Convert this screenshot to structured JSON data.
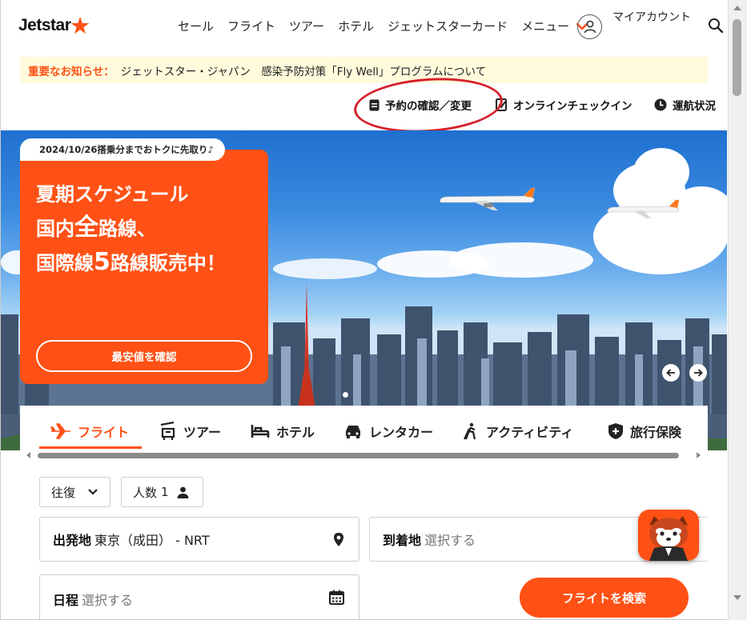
{
  "header": {
    "logo_text": "Jetstar",
    "nav": [
      "セール",
      "フライト",
      "ツアー",
      "ホテル",
      "ジェットスターカード",
      "メニュー"
    ],
    "account_label": "マイアカウント"
  },
  "notice": {
    "label": "重要なお知らせ：",
    "text": "ジェットスター・ジャパン　感染予防対策「Fly Well」プログラムについて"
  },
  "quick_links": {
    "booking": "予約の確認／変更",
    "checkin": "オンラインチェックイン",
    "status": "運航状況"
  },
  "promo": {
    "badge": "2024/10/26搭乗分までおトクに先取り♪",
    "line1": "夏期スケジュール",
    "line2_a": "国内",
    "line2_b": "全",
    "line2_c": "路線、",
    "line3_a": "国際線",
    "line3_b": "5",
    "line3_c": "路線販売中！",
    "cta": "最安値を確認"
  },
  "tabs": [
    {
      "label": "フライト",
      "icon": "plane-icon",
      "active": true
    },
    {
      "label": "ツアー",
      "icon": "tour-icon",
      "active": false
    },
    {
      "label": "ホテル",
      "icon": "bed-icon",
      "active": false
    },
    {
      "label": "レンタカー",
      "icon": "car-icon",
      "active": false
    },
    {
      "label": "アクティビティ",
      "icon": "hiker-icon",
      "active": false
    },
    {
      "label": "旅行保険",
      "icon": "shield-icon",
      "active": false
    }
  ],
  "form": {
    "trip_type": "往復",
    "pax_label": "人数",
    "pax_count": "1",
    "origin_label": "出発地",
    "origin_value": "東京（成田） - NRT",
    "dest_label": "到着地",
    "dest_placeholder": "選択する",
    "date_label": "日程",
    "date_placeholder": "選択する",
    "search_button": "フライトを検索"
  },
  "colors": {
    "brand": "#ff5115",
    "notice_bg": "#fffbdc",
    "annotation": "#d6202a"
  }
}
